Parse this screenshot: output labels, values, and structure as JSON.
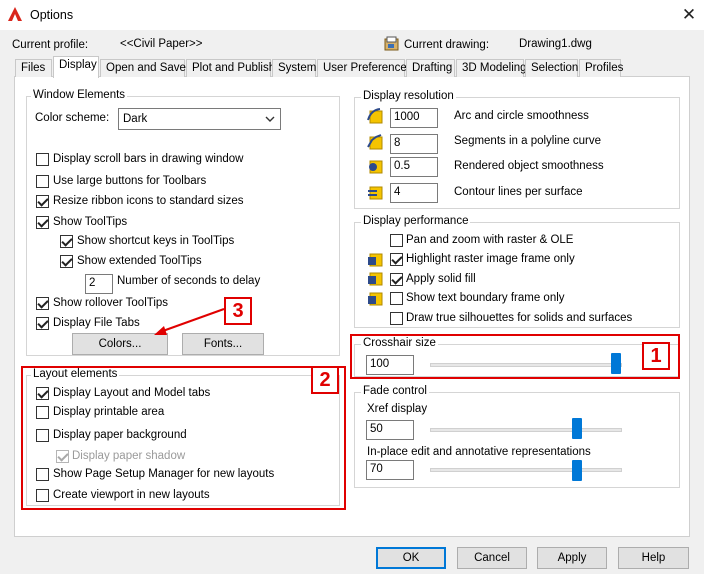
{
  "window": {
    "title": "Options"
  },
  "profile": {
    "label": "Current profile:",
    "value": "<<Civil Paper>>"
  },
  "drawing": {
    "label": "Current drawing:",
    "value": "Drawing1.dwg"
  },
  "tabs": [
    {
      "label": "Files"
    },
    {
      "label": "Display"
    },
    {
      "label": "Open and Save"
    },
    {
      "label": "Plot and Publish"
    },
    {
      "label": "System"
    },
    {
      "label": "User Preferences"
    },
    {
      "label": "Drafting"
    },
    {
      "label": "3D Modeling"
    },
    {
      "label": "Selection"
    },
    {
      "label": "Profiles"
    }
  ],
  "active_tab": "Display",
  "window_elements": {
    "title": "Window Elements",
    "color_scheme_label": "Color scheme:",
    "color_scheme_value": "Dark",
    "scroll_bars": {
      "label": "Display scroll bars in drawing window",
      "checked": false
    },
    "large_buttons": {
      "label": "Use large buttons for Toolbars",
      "checked": false
    },
    "resize_ribbon": {
      "label": "Resize ribbon icons to standard sizes",
      "checked": true
    },
    "show_tooltips": {
      "label": "Show ToolTips",
      "checked": true
    },
    "shortcut_keys": {
      "label": "Show shortcut keys in ToolTips",
      "checked": true
    },
    "extended_tooltips": {
      "label": "Show extended ToolTips",
      "checked": true
    },
    "delay_value": "2",
    "delay_label": "Number of seconds to delay",
    "rollover": {
      "label": "Show rollover ToolTips",
      "checked": true
    },
    "file_tabs": {
      "label": "Display File Tabs",
      "checked": true
    },
    "colors_button": "Colors...",
    "fonts_button": "Fonts..."
  },
  "layout_elements": {
    "title": "Layout elements",
    "layout_model_tabs": {
      "label": "Display Layout and Model tabs",
      "checked": true
    },
    "printable_area": {
      "label": "Display printable area",
      "checked": false
    },
    "paper_background": {
      "label": "Display paper background",
      "checked": false
    },
    "paper_shadow": {
      "label": "Display paper shadow",
      "checked": true,
      "disabled": true
    },
    "page_setup_manager": {
      "label": "Show Page Setup Manager for new layouts",
      "checked": false
    },
    "create_viewport": {
      "label": "Create viewport in new layouts",
      "checked": false
    }
  },
  "display_resolution": {
    "title": "Display resolution",
    "items": [
      {
        "value": "1000",
        "label": "Arc and circle smoothness"
      },
      {
        "value": "8",
        "label": "Segments in a polyline curve"
      },
      {
        "value": "0.5",
        "label": "Rendered object smoothness"
      },
      {
        "value": "4",
        "label": "Contour lines per surface"
      }
    ]
  },
  "display_performance": {
    "title": "Display performance",
    "items": [
      {
        "label": "Pan and zoom with raster & OLE",
        "checked": false,
        "icon": false
      },
      {
        "label": "Highlight raster image frame only",
        "checked": true,
        "icon": true
      },
      {
        "label": "Apply solid fill",
        "checked": true,
        "icon": true
      },
      {
        "label": "Show text boundary frame only",
        "checked": false,
        "icon": true
      },
      {
        "label": "Draw true silhouettes for solids and surfaces",
        "checked": false,
        "icon": false
      }
    ]
  },
  "crosshair": {
    "title": "Crosshair size",
    "value": "100",
    "level_percent": 100
  },
  "fade_control": {
    "title": "Fade control",
    "xref_label": "Xref display",
    "xref_value": "50",
    "xref_level_percent": 50,
    "inplace_label": "In-place edit and annotative representations",
    "inplace_value": "70",
    "inplace_level_percent": 70
  },
  "buttons": {
    "ok": "OK",
    "cancel": "Cancel",
    "apply": "Apply",
    "help": "Help"
  },
  "callouts": {
    "one": "1",
    "two": "2",
    "three": "3"
  },
  "colors": {
    "accent": "#0078d7",
    "callout": "#e00000",
    "resolution_icon": "#f5c400"
  }
}
